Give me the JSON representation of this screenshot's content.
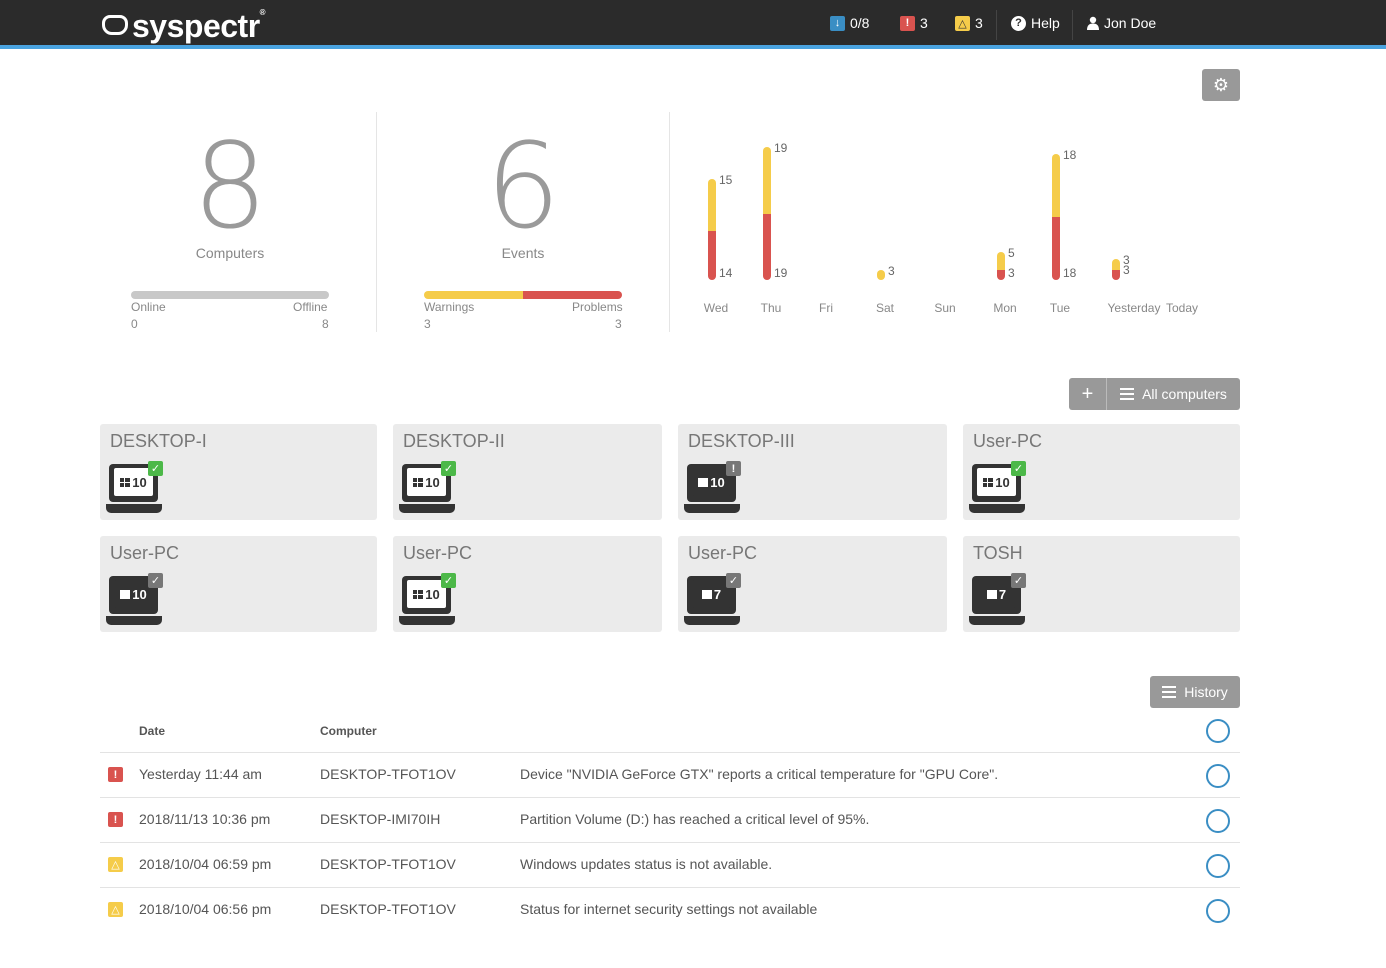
{
  "colors": {
    "topbar": "#2b2b2b",
    "accent": "#4aa3df",
    "warning": "#f5cc4a",
    "problem": "#d9534f",
    "offline_bar": "#c8c8c8",
    "ok": "#4cb848",
    "neutral": "#888888"
  },
  "topbar": {
    "logo": "syspectr",
    "logo_mark": "®",
    "updates_count": "0/8",
    "problems_count": "3",
    "warnings_count": "3",
    "help_label": "Help",
    "user_name": "Jon Doe"
  },
  "stats": {
    "computers": {
      "count": "8",
      "label": "Computers",
      "online_label": "Online",
      "offline_label": "Offline",
      "online": "0",
      "offline": "8"
    },
    "events": {
      "count": "6",
      "label": "Events",
      "warnings_label": "Warnings",
      "problems_label": "Problems",
      "warnings": "3",
      "problems": "3"
    }
  },
  "chart_data": {
    "type": "bar",
    "stacked": true,
    "categories": [
      "Wed",
      "Thu",
      "Fri",
      "Sat",
      "Sun",
      "Mon",
      "Tue",
      "Yesterday",
      "Today"
    ],
    "series": [
      {
        "color": "#d9534f",
        "values": [
          14,
          19,
          0,
          0,
          0,
          3,
          18,
          3,
          0
        ]
      },
      {
        "color": "#f5cc4a",
        "values": [
          15,
          19,
          0,
          3,
          0,
          5,
          18,
          3,
          0
        ]
      }
    ]
  },
  "computers_toolbar": {
    "add_label": "+",
    "all_label": "All computers"
  },
  "computers": [
    {
      "name": "DESKTOP-I",
      "os": "10",
      "status": "ok"
    },
    {
      "name": "DESKTOP-II",
      "os": "10",
      "status": "ok"
    },
    {
      "name": "DESKTOP-III",
      "os": "10",
      "status": "alert"
    },
    {
      "name": "User-PC",
      "os": "10",
      "status": "ok"
    },
    {
      "name": "User-PC",
      "os": "10",
      "status": "offline"
    },
    {
      "name": "User-PC",
      "os": "10",
      "status": "ok"
    },
    {
      "name": "User-PC",
      "os": "7",
      "status": "offline"
    },
    {
      "name": "TOSH",
      "os": "7",
      "status": "offline"
    }
  ],
  "history": {
    "button_label": "History",
    "date_header": "Date",
    "computer_header": "Computer",
    "rows": [
      {
        "severity": "problem",
        "date": "Yesterday 11:44 am",
        "computer": "DESKTOP-TFOT1OV",
        "message": "Device \"NVIDIA GeForce GTX\" reports a critical temperature for \"GPU Core\"."
      },
      {
        "severity": "problem",
        "date": "2018/11/13 10:36 pm",
        "computer": "DESKTOP-IMI70IH",
        "message": "Partition Volume (D:) has reached a critical level of 95%."
      },
      {
        "severity": "warning",
        "date": "2018/10/04 06:59 pm",
        "computer": "DESKTOP-TFOT1OV",
        "message": "Windows updates status is not available."
      },
      {
        "severity": "warning",
        "date": "2018/10/04 06:56 pm",
        "computer": "DESKTOP-TFOT1OV",
        "message": "Status for internet security settings not available"
      }
    ]
  }
}
